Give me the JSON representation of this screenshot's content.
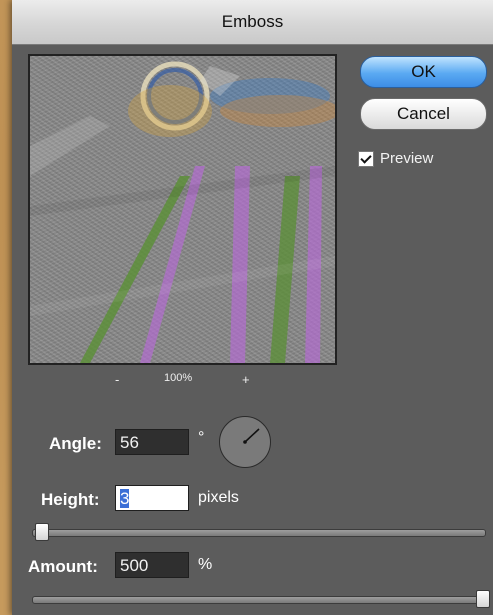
{
  "dialog": {
    "title": "Emboss"
  },
  "buttons": {
    "ok_label": "OK",
    "cancel_label": "Cancel"
  },
  "preview_toggle": {
    "label": "Preview",
    "checked": true
  },
  "zoom": {
    "minus_label": "-",
    "level": "100%",
    "plus_label": "+"
  },
  "settings": {
    "angle": {
      "label": "Angle:",
      "value": "56",
      "unit": "°"
    },
    "height": {
      "label": "Height:",
      "value": "3",
      "unit": "pixels"
    },
    "amount": {
      "label": "Amount:",
      "value": "500",
      "unit": "%"
    }
  },
  "sliders": {
    "height_fraction": 0.0,
    "amount_fraction": 1.0
  },
  "colors": {
    "ok_button": "#5aa9f2",
    "dialog_bg": "#5c5c5c"
  },
  "icons": {
    "angle_dial": "angle-dial-icon",
    "check": "checkmark-icon"
  }
}
